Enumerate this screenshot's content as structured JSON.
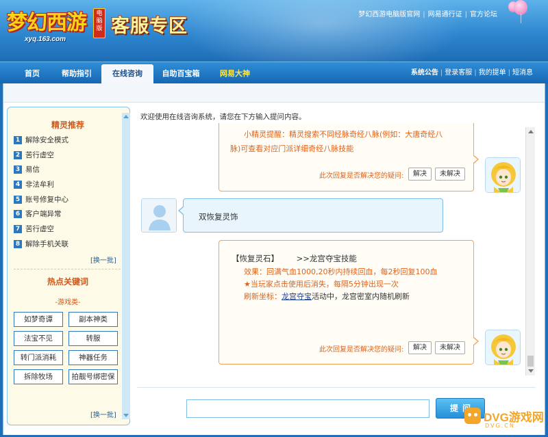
{
  "header": {
    "logo_text": "梦幻西游",
    "logo_badge": "电脑版",
    "logo_url": "xyq.163.com",
    "page_title": "客服专区",
    "top_links": [
      "梦幻西游电脑版官网",
      "网易通行证",
      "官方论坛"
    ]
  },
  "nav": {
    "tabs": [
      {
        "label": "首页"
      },
      {
        "label": "帮助指引"
      },
      {
        "label": "在线咨询"
      },
      {
        "label": "自助百宝箱"
      },
      {
        "label": "网易大神"
      }
    ],
    "active_tab": "在线咨询",
    "right_links": [
      "系统公告",
      "登录客服",
      "我的提单",
      "短消息"
    ]
  },
  "sidebar": {
    "recommend_title": "精灵推荐",
    "items": [
      {
        "num": "1",
        "label": "解除安全模式"
      },
      {
        "num": "2",
        "label": "苦行虚空"
      },
      {
        "num": "3",
        "label": "易信"
      },
      {
        "num": "4",
        "label": "非法牟利"
      },
      {
        "num": "5",
        "label": "账号修复中心"
      },
      {
        "num": "6",
        "label": "客户端异常"
      },
      {
        "num": "7",
        "label": "苦行虚空"
      },
      {
        "num": "8",
        "label": "解除手机关联"
      }
    ],
    "refresh_label": "[换一批]",
    "hot_title": "热点关键词",
    "hot_subtitle": "-游戏类-",
    "keywords": [
      "如梦奇谭",
      "副本神类",
      "法宝不见",
      "转服",
      "转门派消耗",
      "神器任务",
      "拆除牧场",
      "拍靓号绑密保"
    ],
    "refresh_label_2": "[换一批]"
  },
  "chat": {
    "welcome": "欢迎使用在线咨询系统，请您在下方输入提问内容。",
    "msg1": {
      "line1": "小精灵提醒：精灵搜索不同经脉奇经八脉(例如：大唐奇经八",
      "line2": "脉)可查看对应门派详细奇经八脉技能"
    },
    "feedback_prompt": "此次回复是否解决您的疑问:",
    "solved_label": "解决",
    "unsolved_label": "未解决",
    "user_msg": "双恢复灵饰",
    "msg2": {
      "title": "【恢复灵石】",
      "title_extra": ">>龙宫夺宝技能",
      "line1": "效果：回满气血1000,20秒内持续回血，每2秒回复100血",
      "line2": "★当玩家点击使用后消失，每隔5分钟出现一次",
      "line3_prefix": "刷新坐标：",
      "line3_link": "龙宫夺宝",
      "line3_suffix": "活动中，龙宫密室内随机刷新"
    },
    "input_value": "",
    "input_placeholder": "",
    "ask_label": "提问"
  },
  "watermark": {
    "text": "DVG游戏网",
    "sub": "DVG.CN"
  },
  "colors": {
    "header_blue": "#2d86cf",
    "nav_blue": "#1667b3",
    "accent_orange": "#e0631a",
    "sidebar_bg": "#fdfbe7",
    "link_blue": "#1a3fa0"
  }
}
